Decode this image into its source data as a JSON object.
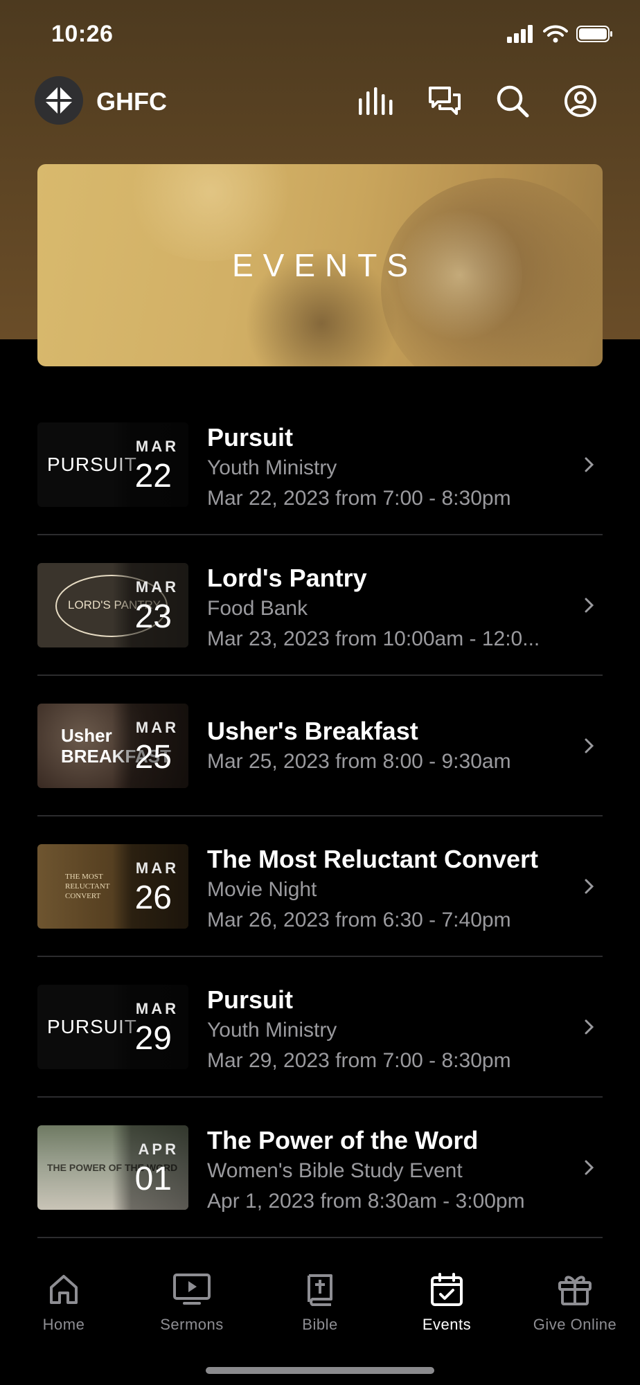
{
  "status_bar": {
    "time": "10:26"
  },
  "header": {
    "brand": "GHFC"
  },
  "banner": {
    "title": "EVENTS"
  },
  "events": [
    {
      "title": "Pursuit",
      "subtitle": "Youth Ministry",
      "when": "Mar 22, 2023 from 7:00 - 8:30pm",
      "thumb_month": "MAR",
      "thumb_day": "22",
      "thumb_text": "PURSUIT",
      "thumb_color": "#0b0b0b"
    },
    {
      "title": "Lord's Pantry",
      "subtitle": "Food Bank",
      "when": "Mar 23, 2023 from 10:00am - 12:0...",
      "thumb_month": "MAR",
      "thumb_day": "23",
      "thumb_text": "LORD'S PANTRY",
      "thumb_color": "#3a342c"
    },
    {
      "title": "Usher's Breakfast",
      "subtitle": "",
      "when": "Mar 25, 2023 from 8:00 - 9:30am",
      "thumb_month": "MAR",
      "thumb_day": "25",
      "thumb_text": "Usher BREAKFAST",
      "thumb_color": "#3b2c24"
    },
    {
      "title": "The Most Reluctant Convert",
      "subtitle": "Movie Night",
      "when": "Mar 26, 2023 from 6:30 - 7:40pm",
      "thumb_month": "MAR",
      "thumb_day": "26",
      "thumb_text": "THE MOST RELUCTANT CONVERT",
      "thumb_color": "#5a4323"
    },
    {
      "title": "Pursuit",
      "subtitle": "Youth Ministry",
      "when": "Mar 29, 2023 from 7:00 - 8:30pm",
      "thumb_month": "MAR",
      "thumb_day": "29",
      "thumb_text": "PURSUIT",
      "thumb_color": "#0b0b0b"
    },
    {
      "title": "The Power of the Word",
      "subtitle": "Women's Bible Study Event",
      "when": "Apr 1, 2023 from 8:30am - 3:00pm",
      "thumb_month": "APR",
      "thumb_day": "01",
      "thumb_text": "THE POWER OF THE WORD",
      "thumb_color": "#8b8f86"
    }
  ],
  "tabs": [
    {
      "label": "Home",
      "icon": "home-icon",
      "active": false
    },
    {
      "label": "Sermons",
      "icon": "tv-play-icon",
      "active": false
    },
    {
      "label": "Bible",
      "icon": "bible-icon",
      "active": false
    },
    {
      "label": "Events",
      "icon": "calendar-check-icon",
      "active": true
    },
    {
      "label": "Give Online",
      "icon": "gift-icon",
      "active": false
    }
  ],
  "colors": {
    "header_brown": "#5e4524",
    "banner_gold": "#d2b066",
    "active_tab": "#ffffff",
    "inactive_tab": "#8e8e93"
  }
}
